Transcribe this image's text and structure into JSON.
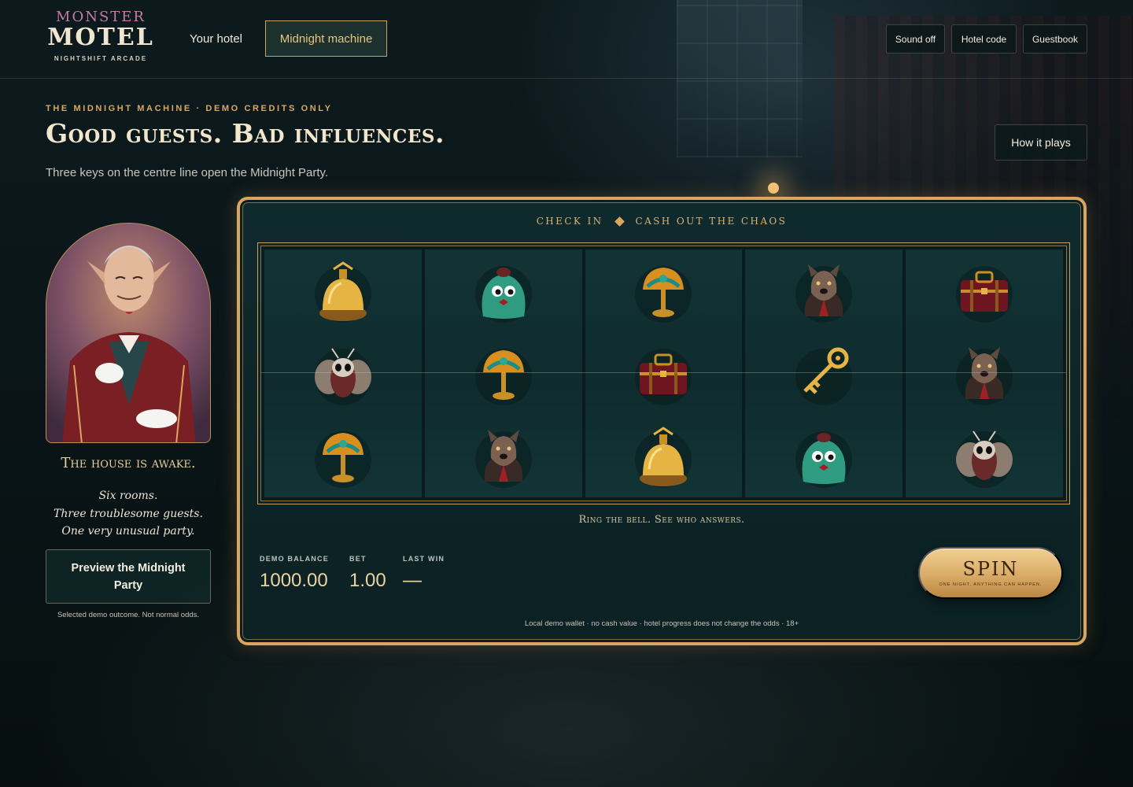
{
  "logo": {
    "top": "MONSTER",
    "main": "MOTEL",
    "sub": "NIGHTSHIFT ARCADE"
  },
  "nav": {
    "your_hotel": "Your hotel",
    "midnight_machine": "Midnight machine"
  },
  "header_buttons": {
    "sound": "Sound off",
    "hotel_code": "Hotel code",
    "guestbook": "Guestbook"
  },
  "hero": {
    "eyebrow": "THE MIDNIGHT MACHINE · DEMO CREDITS ONLY",
    "title": "Good guests. Bad influences.",
    "subtitle": "Three keys on the centre line open the Midnight Party.",
    "how_button": "How it plays"
  },
  "host": {
    "title": "The house is awake.",
    "lines": [
      "Six rooms.",
      "Three troublesome guests.",
      "One very unusual party."
    ],
    "preview_button": "Preview the Midnight Party",
    "preview_note": "Selected demo outcome. Not normal odds."
  },
  "machine": {
    "header_left": "CHECK IN",
    "header_right": "CASH OUT THE CHAOS",
    "reels": [
      [
        "bell-icon",
        "moth-icon",
        "lamp-icon"
      ],
      [
        "slime-icon",
        "lamp-icon",
        "wolf-icon"
      ],
      [
        "lamp-icon",
        "suitcase-icon",
        "bell-icon"
      ],
      [
        "wolf-icon",
        "key-icon",
        "slime-icon"
      ],
      [
        "suitcase-icon",
        "wolf-icon",
        "moth-icon"
      ]
    ],
    "tagline": "Ring the bell. See who answers.",
    "stats": {
      "balance_label": "DEMO BALANCE",
      "balance": "1000.00",
      "bet_label": "BET",
      "bet": "1.00",
      "last_win_label": "LAST WIN",
      "last_win": "—"
    },
    "spin": {
      "label": "SPIN",
      "sub": "ONE NIGHT. ANYTHING CAN HAPPEN."
    },
    "disclaimer": "Local demo wallet · no cash value · hotel progress does not change the odds · 18+"
  },
  "colors": {
    "gold": "#d9a662",
    "teal": "#0f2a2d",
    "accent": "#e8c47e"
  }
}
